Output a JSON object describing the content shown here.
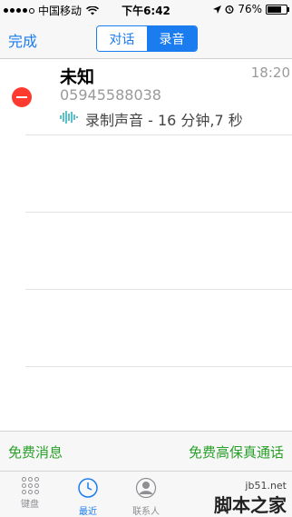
{
  "status": {
    "carrier": "中国移动",
    "time": "下午6:42",
    "battery": "76%",
    "battery_level": 0.76
  },
  "nav": {
    "done": "完成",
    "segments": [
      "对话",
      "录音"
    ],
    "active_segment": "录音"
  },
  "recording": {
    "name": "未知",
    "number": "05945588038",
    "time": "18:20",
    "description": "录制声音 - 16 分钟,7 秒"
  },
  "actions": {
    "free_message": "免费消息",
    "free_call": "免费高保真通话"
  },
  "tabs": [
    {
      "label": "键盘",
      "icon": "keypad-icon"
    },
    {
      "label": "最近",
      "icon": "clock-icon"
    },
    {
      "label": "联系人",
      "icon": "contact-icon"
    }
  ],
  "watermark": {
    "site": "jb51.net",
    "name": "脚本之家"
  }
}
